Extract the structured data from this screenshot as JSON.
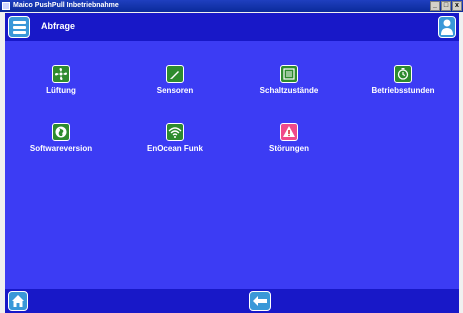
{
  "window": {
    "title": "Maico PushPull Inbetriebnahme",
    "controls": [
      "_",
      "□",
      "x"
    ]
  },
  "header": {
    "title": "Abfrage",
    "menu_icon": "list-menu-icon",
    "user_icon": "user-icon"
  },
  "tiles": [
    {
      "label": "Lüftung",
      "icon": "fan-icon"
    },
    {
      "label": "Sensoren",
      "icon": "pen-icon"
    },
    {
      "label": "Schaltzustände",
      "icon": "list-icon"
    },
    {
      "label": "Betriebsstunden",
      "icon": "clock-icon"
    },
    {
      "label": "Softwareversion",
      "icon": "globe-icon"
    },
    {
      "label": "EnOcean Funk",
      "icon": "wifi-icon"
    },
    {
      "label": "Störungen",
      "icon": "warning-icon"
    }
  ],
  "footer": {
    "home_icon": "home-icon",
    "back_icon": "back-arrow-icon"
  },
  "colors": {
    "main_bg": "#3c3cf4",
    "bar_bg": "#1818c8",
    "icon_green": "#2e8b2e",
    "icon_warning": "#f04a8a",
    "button_blue": "#3a98d8"
  }
}
